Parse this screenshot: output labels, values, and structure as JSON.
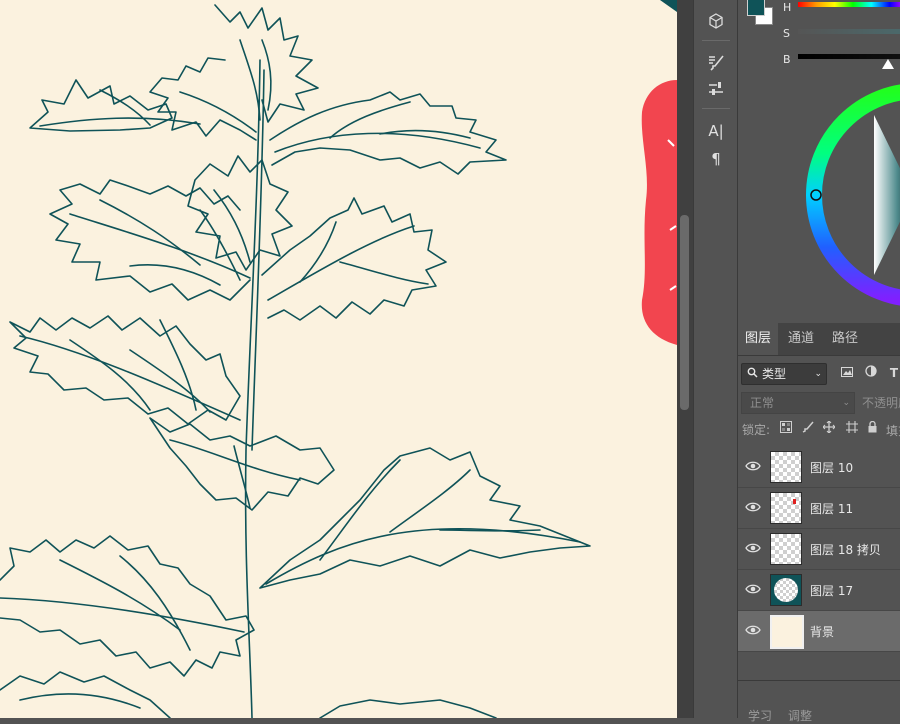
{
  "colors": {
    "canvas": "#fbf2df",
    "ink": "#0f5358",
    "accent_red": "#f2454f",
    "panel": "#535353",
    "panel_dark": "#434343"
  },
  "toolbar": {
    "tools": [
      "3d-tool-icon",
      "brush-settings-icon",
      "brush-icon",
      "adjustments-icon",
      "character-icon",
      "paragraph-icon"
    ],
    "character_glyph": "A|",
    "paragraph_glyph": "¶"
  },
  "color_panel": {
    "h_label": "H",
    "s_label": "S",
    "b_label": "B"
  },
  "layers_panel": {
    "tabs": [
      {
        "label": "图层",
        "active": true
      },
      {
        "label": "通道",
        "active": false
      },
      {
        "label": "路径",
        "active": false
      }
    ],
    "filter_kind": "类型",
    "filter_icons": [
      "image-filter-icon",
      "adjustment-filter-icon",
      "type-filter-icon"
    ],
    "type_glyph": "T",
    "blend_mode": "正常",
    "opacity_label": "不透明度",
    "lock_label": "锁定:",
    "fill_label": "填充",
    "layers": [
      {
        "name": "图层 10",
        "visible": true,
        "selected": false,
        "thumb": "transparent"
      },
      {
        "name": "图层 11",
        "visible": true,
        "selected": false,
        "thumb": "transparent-red-dot"
      },
      {
        "name": "图层 18 拷贝",
        "visible": true,
        "selected": false,
        "thumb": "transparent"
      },
      {
        "name": "图层 17",
        "visible": true,
        "selected": false,
        "thumb": "teal-circle"
      },
      {
        "name": "背景",
        "visible": true,
        "selected": true,
        "thumb": "cream"
      }
    ],
    "bottom_tabs": [
      "学习",
      "调整"
    ]
  }
}
